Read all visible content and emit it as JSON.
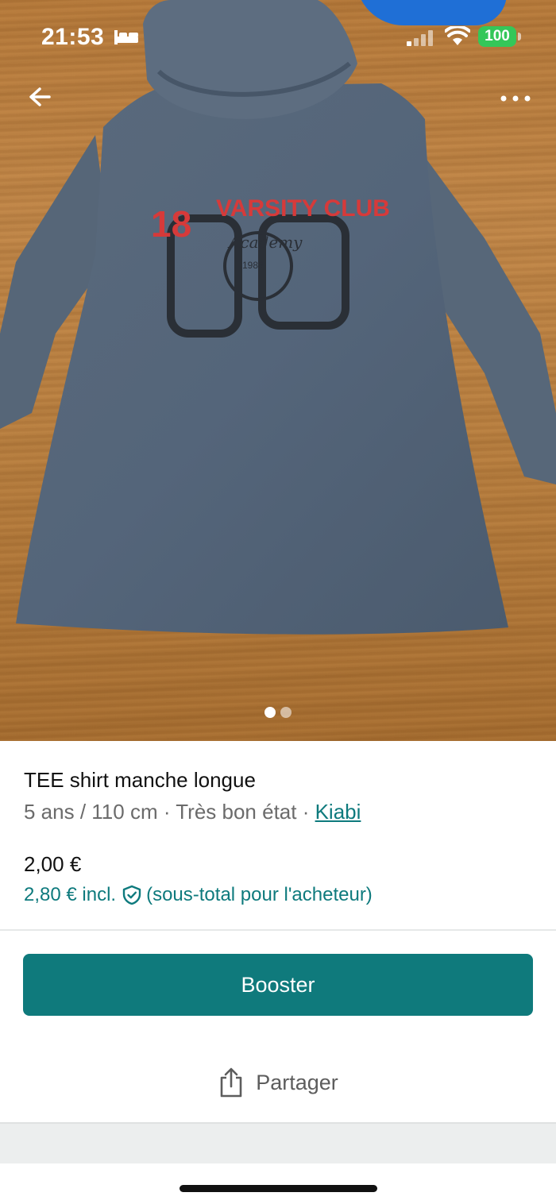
{
  "status_bar": {
    "time": "21:53",
    "battery": "100",
    "battery_color": "#34c759"
  },
  "photo": {
    "print_text_top": "VARSITY CLUB",
    "print_number_small": "18",
    "print_number_large": "83",
    "print_script": "Academy",
    "print_year": "1983",
    "pager": {
      "count": 2,
      "active": 0
    }
  },
  "nav": {
    "back_icon": "arrow-left-icon",
    "more_icon": "more-horizontal-icon"
  },
  "item": {
    "title": "TEE shirt manche longue",
    "meta_prefix": "5 ans / 110 cm · Très bon état · ",
    "brand": "Kiabi",
    "price": "2,00 €",
    "price_incl": "2,80 € incl.",
    "price_incl_note": "(sous-total pour l'acheteur)"
  },
  "actions": {
    "booster_label": "Booster",
    "share_label": "Partager"
  },
  "colors": {
    "accent": "#0f7a7c",
    "link": "#0e7a7d"
  }
}
